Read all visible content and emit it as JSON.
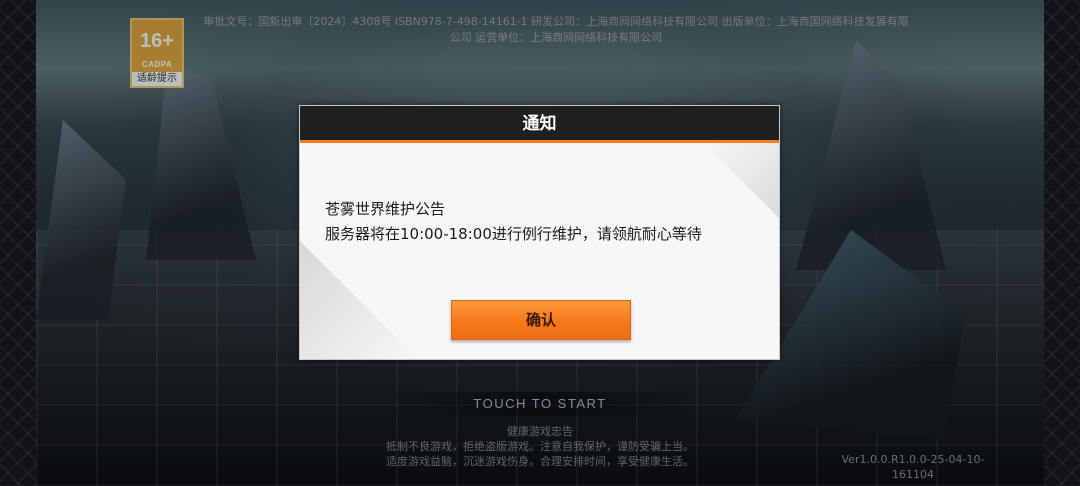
{
  "age_rating": {
    "number": "16+",
    "org": "CADPA",
    "label": "适龄提示"
  },
  "license": {
    "line1": "审批文号：国新出审〔2024〕4308号 ISBN978-7-498-14161-1 研发公司：上海商网网络科技有限公司 出版单位：上海商国网络科技发展有限",
    "line2": "公司 运营单位：上海商网网络科技有限公司"
  },
  "notice_dialog": {
    "title": "通知",
    "line1": "苍雾世界维护公告",
    "line2": "服务器将在10:00-18:00进行例行维护，请领航耐心等待",
    "confirm_label": "确认"
  },
  "footer": {
    "touch_to_start": "TOUCH TO START",
    "health_title": "健康游戏忠告",
    "health_line1": "抵制不良游戏，拒绝盗版游戏。注意自我保护，谨防受骗上当。",
    "health_line2": "适度游戏益脑，沉迷游戏伤身。合理安排时间，享受健康生活。",
    "version_line1": "Ver1.0.0.R1.0.0-25-04-10-",
    "version_line2": "161104"
  },
  "colors": {
    "accent": "#f07f21",
    "header_bg": "#1f1f1f"
  }
}
